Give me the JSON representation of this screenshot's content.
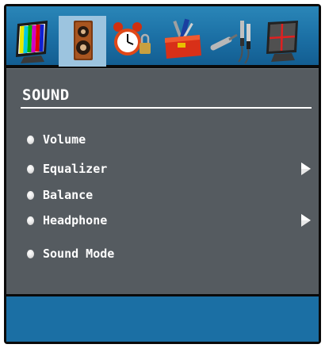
{
  "tabs": [
    {
      "icon": "picture-icon",
      "selected": false
    },
    {
      "icon": "sound-speaker-icon",
      "selected": true
    },
    {
      "icon": "alarm-clock-icon",
      "selected": false
    },
    {
      "icon": "toolbox-icon",
      "selected": false
    },
    {
      "icon": "cables-icon",
      "selected": false
    },
    {
      "icon": "source-screen-icon",
      "selected": false
    }
  ],
  "menu": {
    "title": "SOUND",
    "items": [
      {
        "label": "Volume",
        "has_submenu": false
      },
      {
        "label": "Equalizer",
        "has_submenu": true
      },
      {
        "label": "Balance",
        "has_submenu": false
      },
      {
        "label": "Headphone",
        "has_submenu": true
      },
      {
        "label": "Sound Mode",
        "has_submenu": false
      }
    ]
  },
  "colors": {
    "icon_bar": "#1b6fa4",
    "menu_panel": "#555b60",
    "selected_tab": "#9cc4df",
    "frame": "#0a0a0a",
    "text": "#ffffff"
  }
}
